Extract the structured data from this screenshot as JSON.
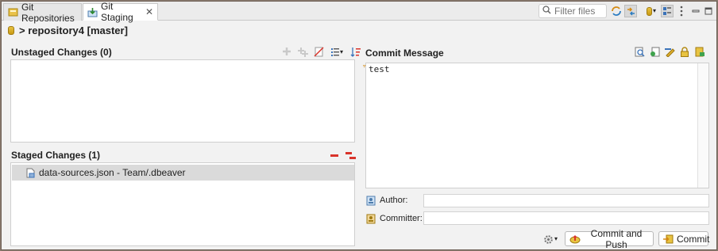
{
  "tabs": [
    {
      "label": "Git Repositories",
      "icon": "git-repositories-icon"
    },
    {
      "label": "Git Staging",
      "icon": "git-staging-icon"
    }
  ],
  "toolbar": {
    "filter_placeholder": "Filter files"
  },
  "repository": {
    "path": "> repository4 [master]"
  },
  "unstaged": {
    "title": "Unstaged Changes (0)",
    "files": []
  },
  "staged": {
    "title": "Staged Changes (1)",
    "files": [
      {
        "label": "data-sources.json - Team/.dbeaver"
      }
    ]
  },
  "commit": {
    "title": "Commit Message",
    "message": "test",
    "author_label": "Author:",
    "author_value": "",
    "committer_label": "Committer:",
    "committer_value": "",
    "commit_and_push_label": "Commit and Push",
    "commit_label": "Commit"
  },
  "colors": {
    "accent_red": "#d9342b",
    "accent_yellow": "#e0b12d",
    "selection": "#dadada"
  }
}
